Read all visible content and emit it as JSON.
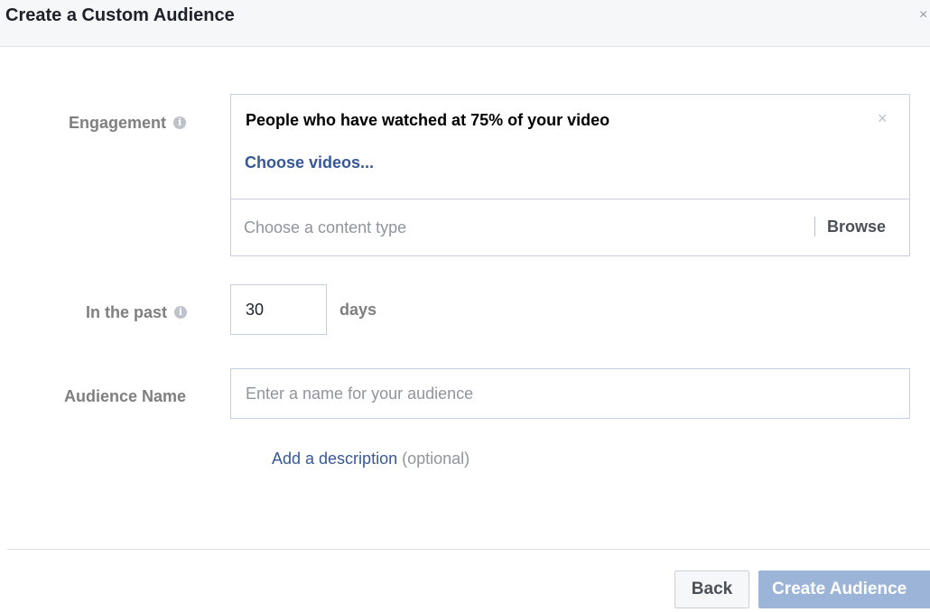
{
  "dialog": {
    "title": "Create a Custom Audience",
    "close_icon": "close-icon",
    "close_glyph": "×"
  },
  "engagement": {
    "label": "Engagement",
    "info_icon": "info-icon",
    "info_glyph": "i",
    "selected_title": "People who have watched at 75% of your video",
    "remove_glyph": "×",
    "choose_videos_label": "Choose videos...",
    "content_type_placeholder": "Choose a content type",
    "content_type_value": "",
    "browse_label": "Browse"
  },
  "retention": {
    "label": "In the past",
    "info_icon": "info-icon",
    "info_glyph": "i",
    "days_value": "30",
    "days_unit": "days"
  },
  "audience_name": {
    "label": "Audience Name",
    "placeholder": "Enter a name for your audience",
    "value": ""
  },
  "description": {
    "link_label": "Add a description",
    "optional_label": "(optional)"
  },
  "footer": {
    "back_label": "Back",
    "create_label": "Create Audience",
    "create_enabled": false
  },
  "colors": {
    "link": "#365899",
    "primary_disabled": "#9cb4d8",
    "label_gray": "#7f7f7f",
    "border": "#c5cfe2"
  }
}
